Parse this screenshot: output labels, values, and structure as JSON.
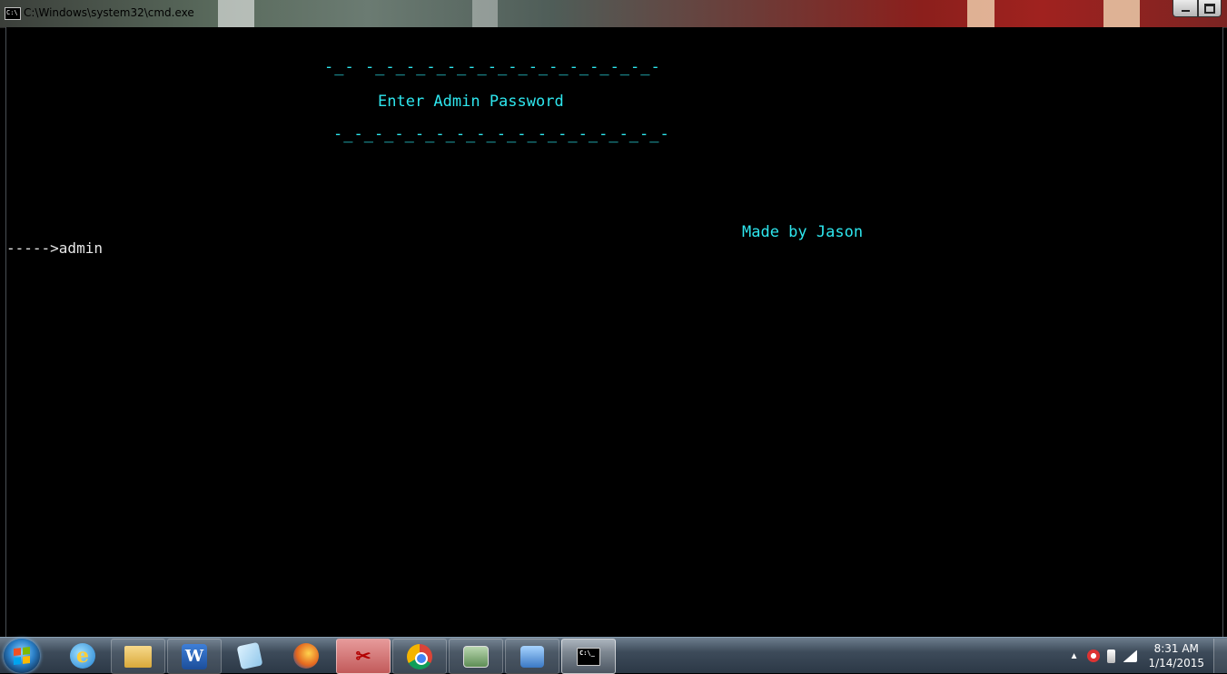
{
  "window": {
    "title": "C:\\Windows\\system32\\cmd.exe",
    "icon": "cmd-icon",
    "controls": [
      "minimize-icon",
      "maximize-icon"
    ]
  },
  "console": {
    "text_color": "#2ee6ee",
    "background": "#000000",
    "dash_line_top": "-_- -_-_-_-_-_-_-_-_-_-_-_-_-_-_-",
    "heading": "Enter Admin Password",
    "dash_line_bottom": "-_-_-_-_-_-_-_-_-_-_-_-_-_-_-_-_-",
    "credit": "Made by Jason",
    "prompt_line": "----->admin"
  },
  "taskbar": {
    "start_icon": "windows-start-icon",
    "items": [
      {
        "name": "internet-explorer-icon"
      },
      {
        "name": "windows-explorer-icon"
      },
      {
        "name": "microsoft-word-icon",
        "label": "W"
      },
      {
        "name": "sticky-notes-icon"
      },
      {
        "name": "firefox-icon"
      },
      {
        "name": "snipping-tool-icon"
      },
      {
        "name": "chrome-icon"
      },
      {
        "name": "task-manager-icon"
      },
      {
        "name": "remote-desktop-icon"
      },
      {
        "name": "command-prompt-icon",
        "label": "C:\\_",
        "active": true
      }
    ],
    "tray": {
      "icons": [
        "show-hidden-icons-arrow",
        "action-center-icon",
        "power-icon",
        "network-signal-icon"
      ],
      "time": "8:31 AM",
      "date": "1/14/2015"
    }
  }
}
